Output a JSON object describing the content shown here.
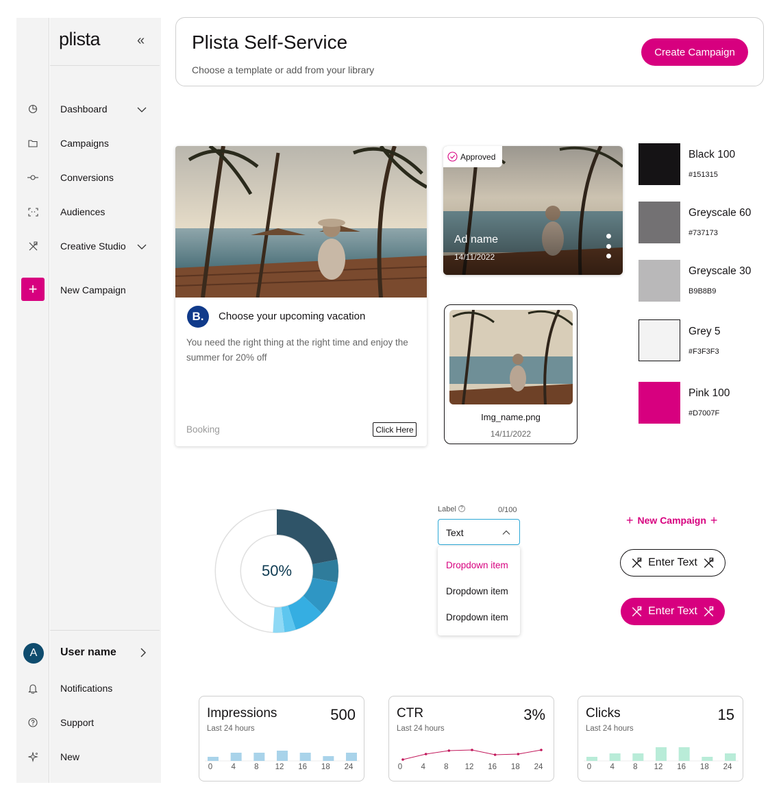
{
  "app": {
    "logo_text": "plista",
    "collapse_glyph": "«"
  },
  "sidebar": {
    "items": [
      {
        "label": "Dashboard",
        "icon": "pie-chart-icon",
        "has_chevron": true
      },
      {
        "label": "Campaigns",
        "icon": "folder-icon",
        "has_chevron": false
      },
      {
        "label": "Conversions",
        "icon": "commit-icon",
        "has_chevron": false
      },
      {
        "label": "Audiences",
        "icon": "face-scan-icon",
        "has_chevron": false
      },
      {
        "label": "Creative Studio",
        "icon": "design-tools-icon",
        "has_chevron": true
      }
    ],
    "new_campaign": {
      "label": "New Campaign",
      "icon": "plus-icon"
    },
    "user": {
      "initial": "A",
      "name": "User name"
    },
    "bottom_items": [
      {
        "label": "Notifications",
        "icon": "bell-icon"
      },
      {
        "label": "Support",
        "icon": "help-circle-icon"
      },
      {
        "label": "New",
        "icon": "sparkle-icon"
      }
    ]
  },
  "header": {
    "title": "Plista Self-Service",
    "subtitle": "Choose a template or add from your library",
    "cta_label": "Create Campaign"
  },
  "ad_card": {
    "brand_initial": "B.",
    "title": "Choose your upcoming vacation",
    "description": "You need the right thing at the right time and enjoy the summer for 20% off",
    "source": "Booking",
    "cta": "Click Here"
  },
  "ad_tile": {
    "status": "Approved",
    "name": "Ad name",
    "date": "14/11/2022"
  },
  "file_card": {
    "filename": "Img_name.png",
    "date": "14/11/2022"
  },
  "swatches": [
    {
      "name": "Black 100",
      "hex_label": "#151315",
      "color": "#151315"
    },
    {
      "name": "Greyscale 60",
      "hex_label": "#737173",
      "color": "#737173"
    },
    {
      "name": "Greyscale 30",
      "hex_label": "B9B8B9",
      "color": "#B9B8B9"
    },
    {
      "name": "Grey 5",
      "hex_label": "#F3F3F3",
      "color": "#F3F3F3"
    },
    {
      "name": "Pink 100",
      "hex_label": "#D7007F",
      "color": "#D7007F"
    }
  ],
  "donut": {
    "label": "50%",
    "segments": [
      {
        "value": 0.22,
        "color": "#2f5468"
      },
      {
        "value": 0.06,
        "color": "#2f7c9b"
      },
      {
        "value": 0.09,
        "color": "#2f96c4"
      },
      {
        "value": 0.08,
        "color": "#35aee2"
      },
      {
        "value": 0.03,
        "color": "#5ec6ef"
      },
      {
        "value": 0.03,
        "color": "#8fd9f5"
      },
      {
        "value": 0.49,
        "color": "none"
      }
    ]
  },
  "dropdown": {
    "label": "Label",
    "counter": "0/100",
    "value": "Text",
    "items": [
      "Dropdown item",
      "Dropdown item",
      "Dropdown item"
    ],
    "active_index": 0
  },
  "buttons": {
    "new_campaign": "New Campaign",
    "enter_text_outline": "Enter Text",
    "enter_text_filled": "Enter Text"
  },
  "stats": [
    {
      "title": "Impressions",
      "value": "500",
      "subtitle": "Last 24 hours",
      "chart_type": "bar",
      "color": "#a9d3ea",
      "values": [
        0.3,
        0.6,
        0.6,
        0.75,
        0.6,
        0.35,
        0.6
      ],
      "ticks": [
        "0",
        "4",
        "8",
        "12",
        "16",
        "18",
        "24"
      ]
    },
    {
      "title": "CTR",
      "value": "3%",
      "subtitle": "Last 24 hours",
      "chart_type": "line",
      "color": "#c2185b",
      "values": [
        0.1,
        0.5,
        0.75,
        0.8,
        0.45,
        0.5,
        0.8
      ],
      "ticks": [
        "0",
        "4",
        "8",
        "12",
        "16",
        "18",
        "24"
      ]
    },
    {
      "title": "Clicks",
      "value": "15",
      "subtitle": "Last 24 hours",
      "chart_type": "bar",
      "color": "#b9ecd8",
      "values": [
        0.3,
        0.55,
        0.55,
        1.0,
        1.0,
        0.3,
        0.55
      ],
      "ticks": [
        "0",
        "4",
        "8",
        "12",
        "16",
        "18",
        "24"
      ]
    }
  ]
}
